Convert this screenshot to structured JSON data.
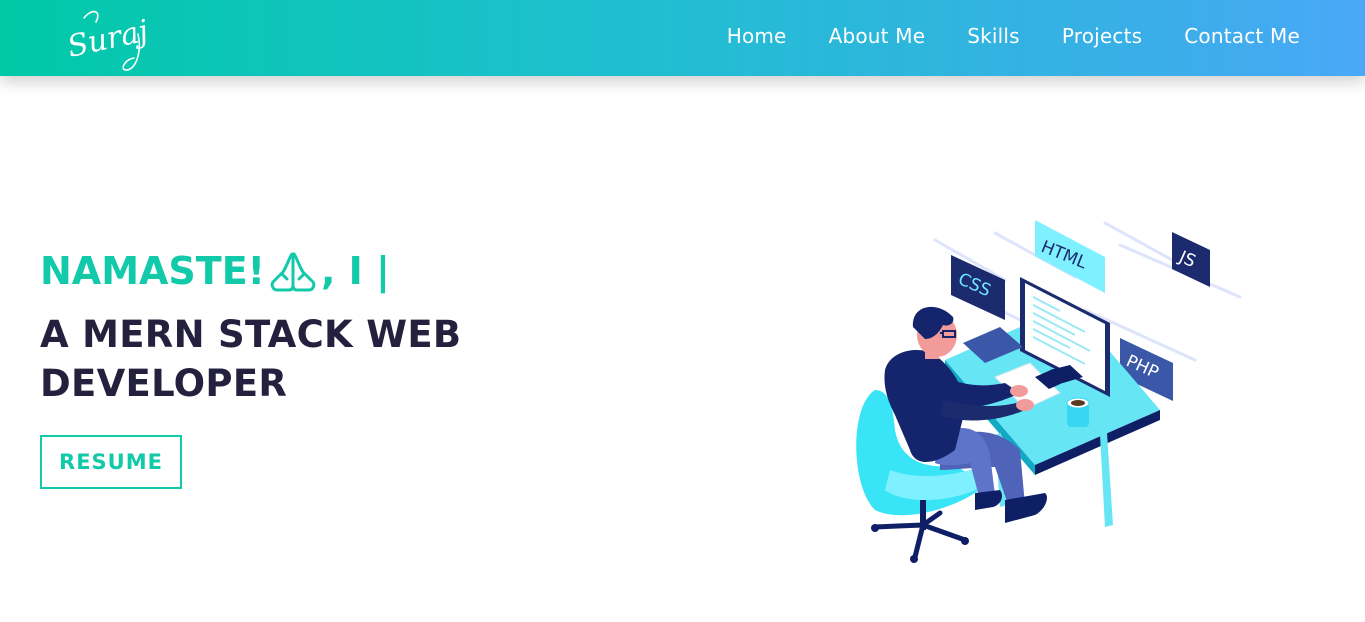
{
  "nav": {
    "logo_text": "Suraj",
    "links": [
      "Home",
      "About Me",
      "Skills",
      "Projects",
      "Contact Me"
    ]
  },
  "hero": {
    "greeting": "NAMASTE!",
    "greeting_suffix": ", I |",
    "headline": "A MERN STACK WEB DEVELOPER",
    "resume_label": "RESUME",
    "illustration": {
      "tags": [
        "HTML",
        "CSS",
        "JS",
        "PHP"
      ]
    }
  },
  "colors": {
    "accent": "#12c9aa",
    "headline": "#23213d",
    "nav_gradient_start": "#00c9a7",
    "nav_gradient_end": "#4aa8f8"
  },
  "icons": {
    "greeting_icon": "folded-hands-icon"
  }
}
